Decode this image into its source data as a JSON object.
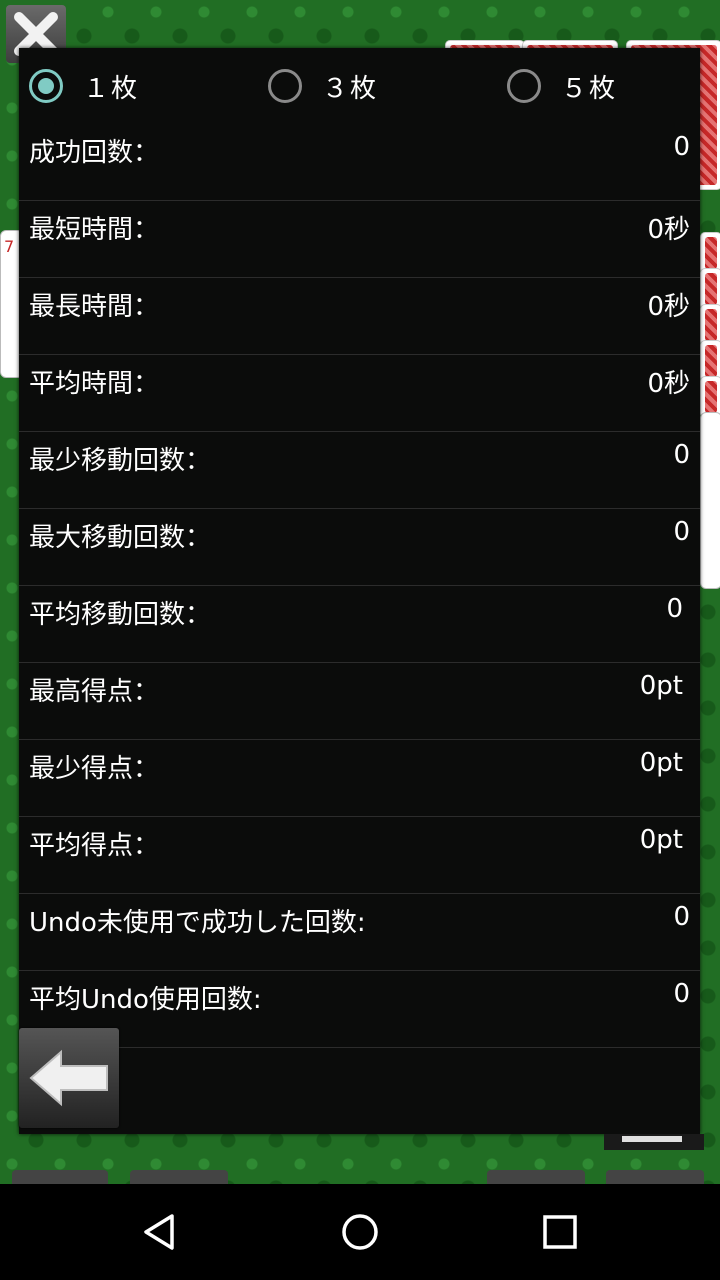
{
  "radio_options": [
    {
      "label": "１枚",
      "selected": true
    },
    {
      "label": "３枚",
      "selected": false
    },
    {
      "label": "５枚",
      "selected": false
    }
  ],
  "stats": [
    {
      "label": "成功回数：",
      "value": "0"
    },
    {
      "label": "最短時間：",
      "value": "0秒"
    },
    {
      "label": "最長時間：",
      "value": "0秒"
    },
    {
      "label": "平均時間：",
      "value": "0秒"
    },
    {
      "label": "最少移動回数：",
      "value": "0"
    },
    {
      "label": "最大移動回数：",
      "value": "0"
    },
    {
      "label": "平均移動回数：",
      "value": "0"
    },
    {
      "label": "最高得点：",
      "value": "0pt"
    },
    {
      "label": "最少得点：",
      "value": "0pt"
    },
    {
      "label": "平均得点：",
      "value": "0pt"
    },
    {
      "label": "Undo未使用で成功した回数:",
      "value": "0"
    },
    {
      "label": "平均Undo使用回数:",
      "value": "0"
    }
  ],
  "icons": {
    "close": "close-icon",
    "back": "back-arrow-icon",
    "nav_back": "nav-back-icon",
    "nav_home": "nav-home-icon",
    "nav_recents": "nav-recents-icon"
  },
  "colors": {
    "felt": "#216e24",
    "panel": "#0b0c0b",
    "radio_accent": "#80cbc4"
  }
}
